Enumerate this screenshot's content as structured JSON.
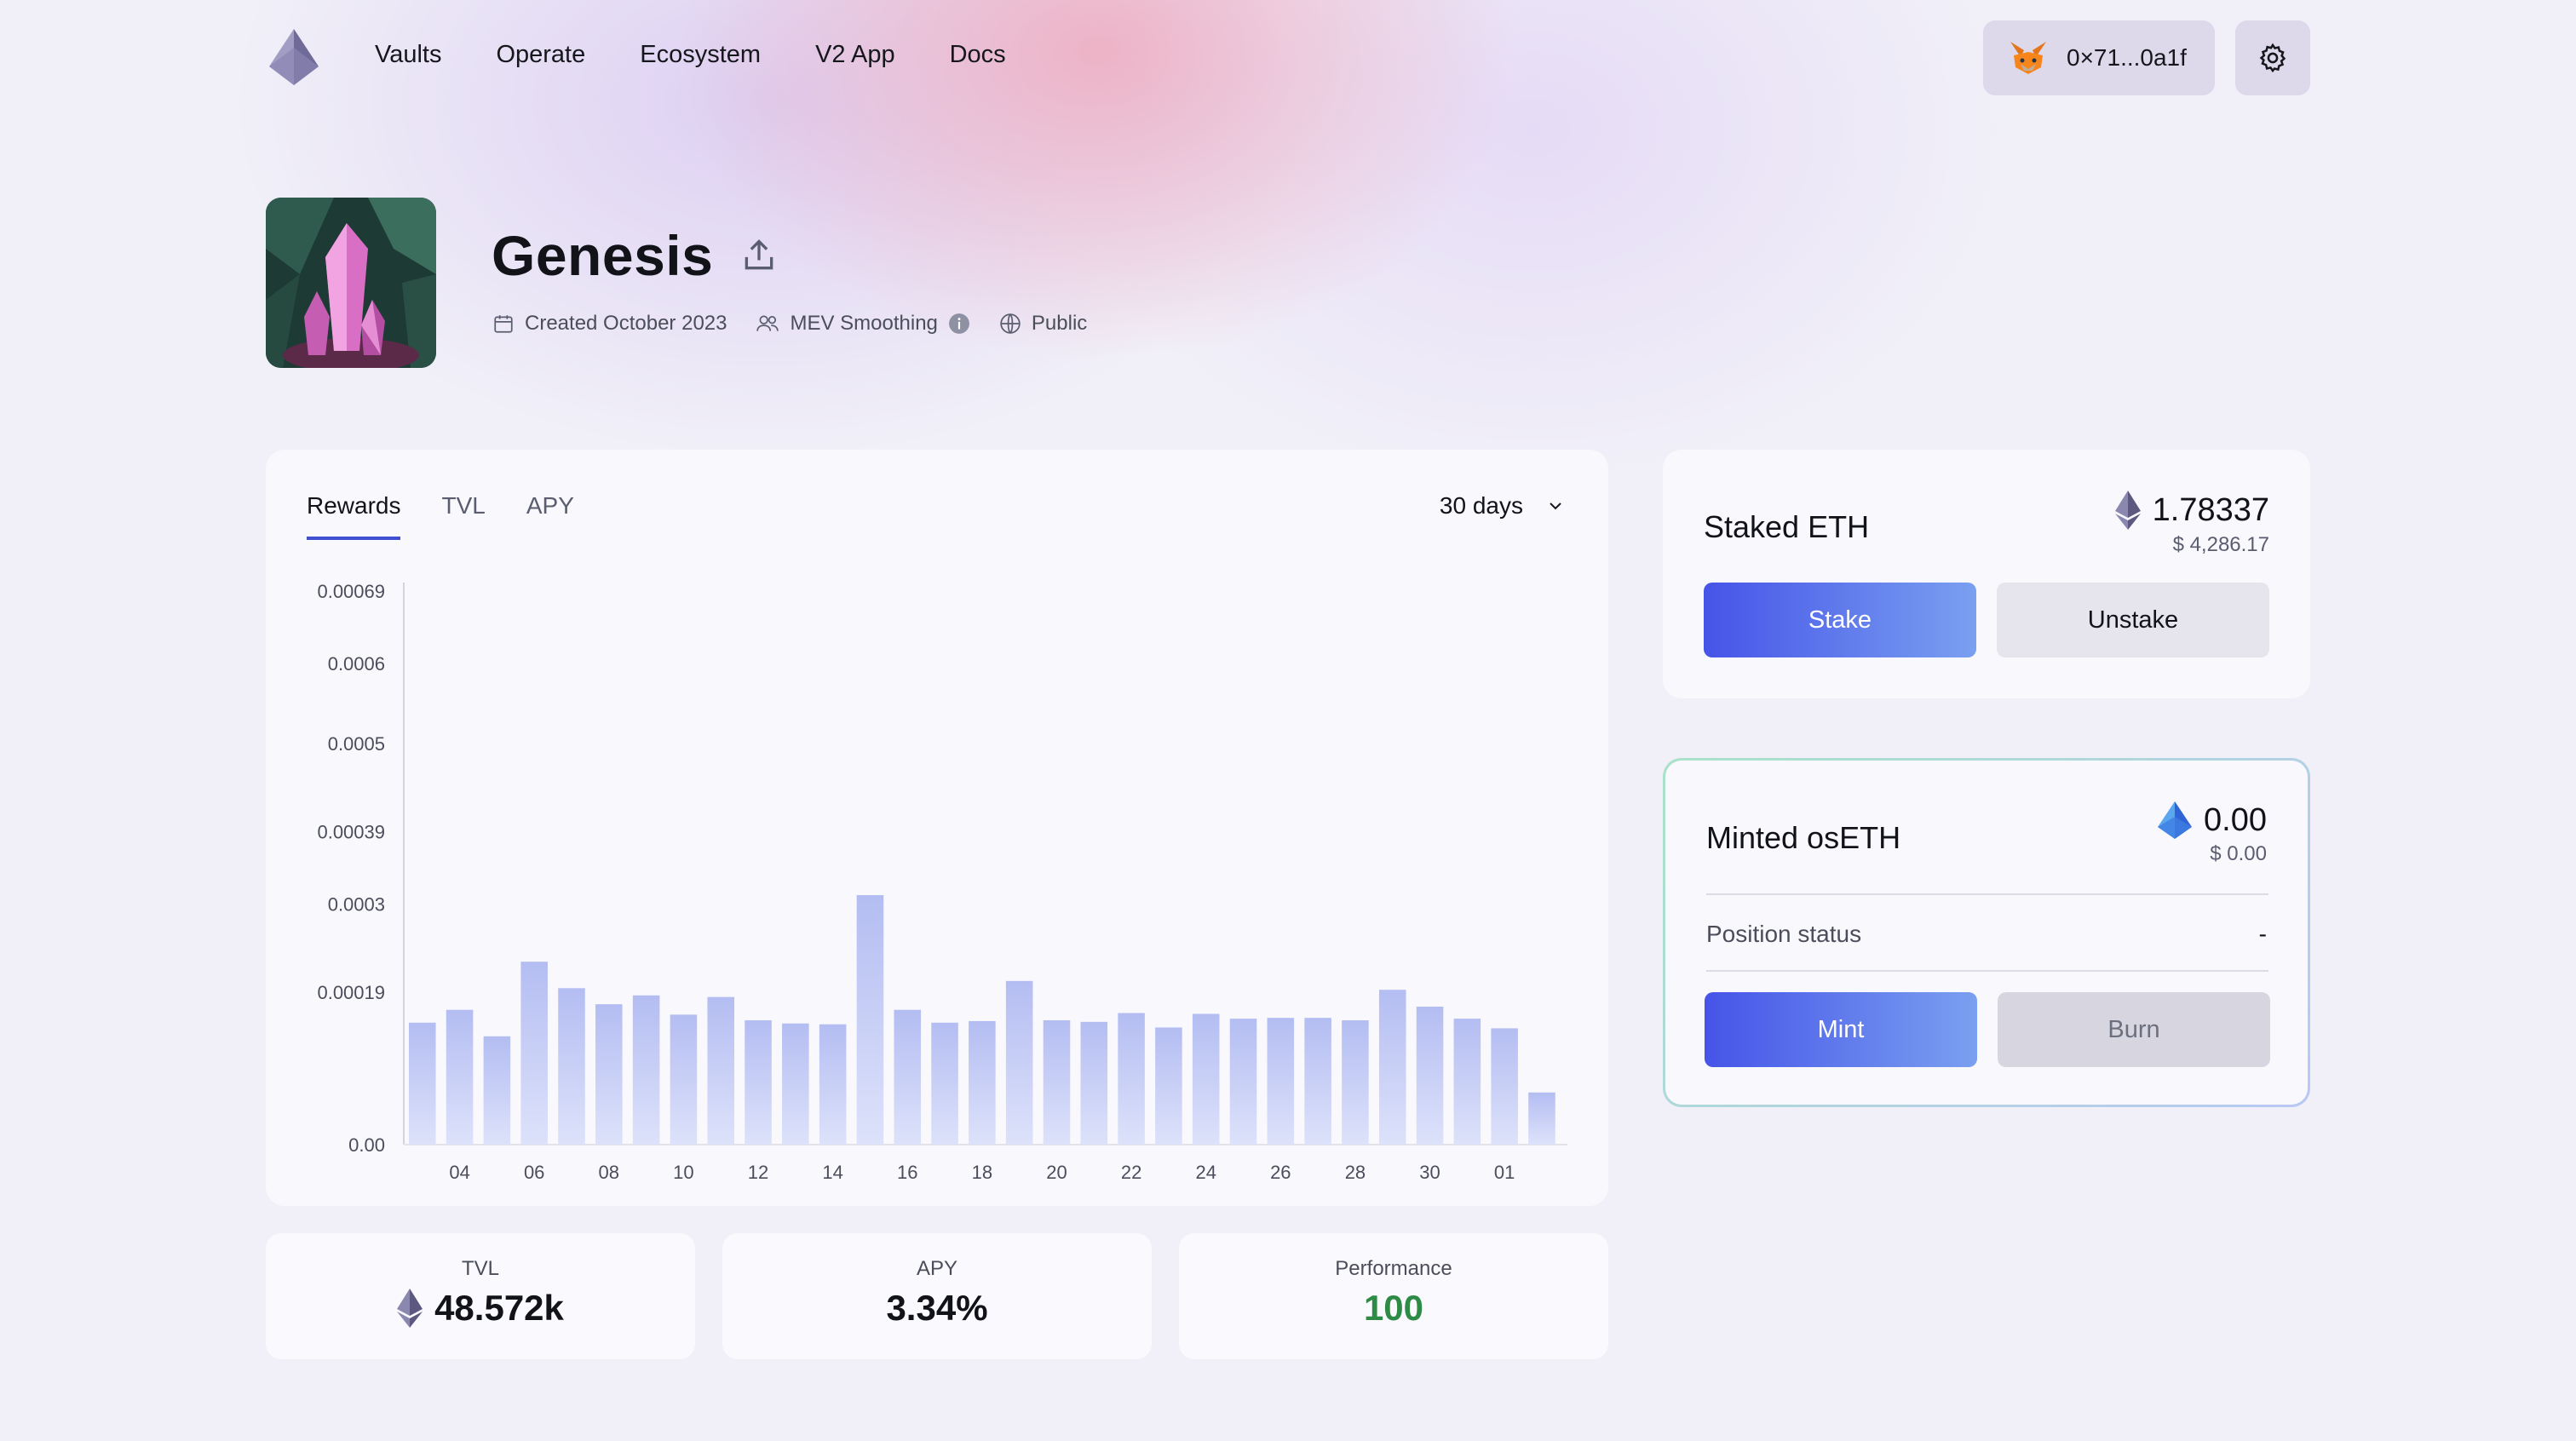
{
  "nav": {
    "links": [
      "Vaults",
      "Operate",
      "Ecosystem",
      "V2 App",
      "Docs"
    ],
    "wallet_address": "0×71...0a1f"
  },
  "vault": {
    "title": "Genesis",
    "created": "Created October 2023",
    "mev": "MEV Smoothing",
    "visibility": "Public"
  },
  "chart_panel": {
    "tabs": [
      "Rewards",
      "TVL",
      "APY"
    ],
    "active_tab": "Rewards",
    "period": "30 days"
  },
  "chart_data": {
    "type": "bar",
    "ylim": [
      0,
      0.00069
    ],
    "y_ticks": [
      "0.00069",
      "0.0006",
      "0.0005",
      "0.00039",
      "0.0003",
      "0.00019",
      "0.00"
    ],
    "y_tick_values": [
      0.00069,
      0.0006,
      0.0005,
      0.00039,
      0.0003,
      0.00019,
      0
    ],
    "x_ticks": [
      "04",
      "06",
      "08",
      "10",
      "12",
      "14",
      "16",
      "18",
      "20",
      "22",
      "24",
      "26",
      "28",
      "30",
      "01"
    ],
    "values": [
      0.000152,
      0.000168,
      0.000135,
      0.000228,
      0.000195,
      0.000175,
      0.000186,
      0.000162,
      0.000184,
      0.000155,
      0.000151,
      0.00015,
      0.000311,
      0.000168,
      0.000152,
      0.000154,
      0.000204,
      0.000155,
      0.000153,
      0.000164,
      0.000146,
      0.000163,
      0.000157,
      0.000158,
      0.000158,
      0.000155,
      0.000193,
      0.000172,
      0.000157,
      0.000145,
      6.5e-05
    ],
    "color": "#b4bdf2"
  },
  "stats": {
    "tvl_label": "TVL",
    "tvl_value": "48.572k",
    "apy_label": "APY",
    "apy_value": "3.34%",
    "performance_label": "Performance",
    "performance_value": "100",
    "performance_color": "#2e8b45"
  },
  "staked": {
    "title": "Staked ETH",
    "amount": "1.78337",
    "usd": "$ 4,286.17",
    "stake_label": "Stake",
    "unstake_label": "Unstake"
  },
  "minted": {
    "title": "Minted osETH",
    "amount": "0.00",
    "usd": "$ 0.00",
    "position_label": "Position status",
    "position_value": "-",
    "mint_label": "Mint",
    "burn_label": "Burn"
  },
  "icons": [
    "stakewise-logo-icon",
    "metamask-fox-icon",
    "gear-icon",
    "share-icon",
    "calendar-icon",
    "users-icon",
    "info-icon",
    "globe-icon",
    "chevron-down-icon",
    "eth-icon",
    "oseth-icon"
  ]
}
